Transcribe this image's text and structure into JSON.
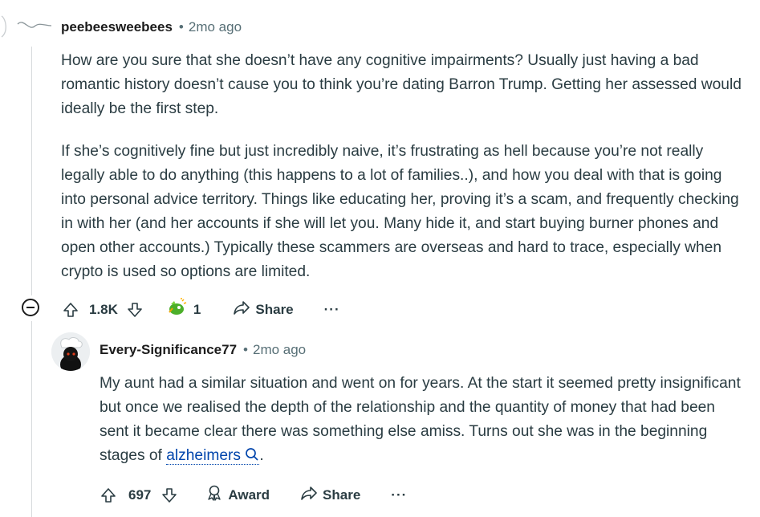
{
  "comment1": {
    "author": "peebeesweebees",
    "time": "2mo ago",
    "paragraph1": "How are you sure that she doesn’t have any cognitive impairments? Usually just having a bad romantic history doesn’t cause you to think you’re dating Barron Trump. Getting her assessed would ideally be the first step.",
    "paragraph2": "If she’s cognitively fine but just incredibly naive, it’s frustrating as hell because you’re not really legally able to do anything (this happens to a lot of families..), and how you deal with that is going into personal advice territory. Things like educating her, proving it’s a scam, and frequently checking in with her (and her accounts if she will let you. Many hide it, and start buying burner phones and open other accounts.) Typically these scammers are overseas and hard to trace, especially when crypto is used so options are limited.",
    "votes": "1.8K",
    "award_count": "1",
    "share_label": "Share",
    "more_label": "···"
  },
  "comment2": {
    "author": "Every-Significance77",
    "time": "2mo ago",
    "text_before": "My aunt had a similar situation and went on for years. At the start it seemed pretty insignificant but once we realised the depth of the relationship and the quantity of money that had been sent it became clear there was something else amiss. Turns out she was in the beginning stages of ",
    "link_text": "alzheimers",
    "text_after": ".",
    "votes": "697",
    "award_label": "Award",
    "share_label": "Share",
    "more_label": "···"
  },
  "separator": "•"
}
